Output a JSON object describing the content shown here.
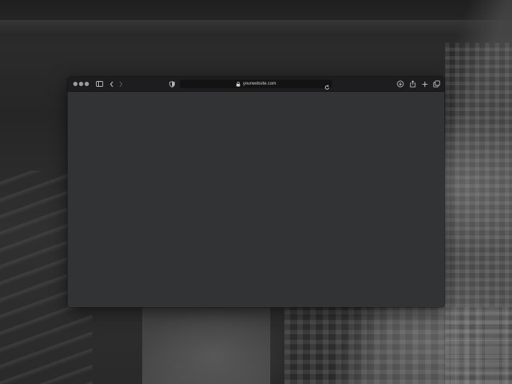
{
  "browser": {
    "address_bar": {
      "url_text": "yourwebsite.com",
      "secure_icon": "lock-icon"
    },
    "toolbar_icons": {
      "sidebar": "sidebar-toggle-icon",
      "back": "chevron-left-icon",
      "forward": "chevron-right-icon",
      "privacy": "shield-icon",
      "reload": "reload-icon",
      "downloads": "download-icon",
      "share": "share-icon",
      "new_tab": "plus-icon",
      "tabs_overview": "tabs-icon"
    },
    "colors": {
      "toolbar_bg": "#1d1d1f",
      "content_bg": "#323335",
      "address_bg": "#131314",
      "traffic_light": "#9d9d9f"
    }
  }
}
